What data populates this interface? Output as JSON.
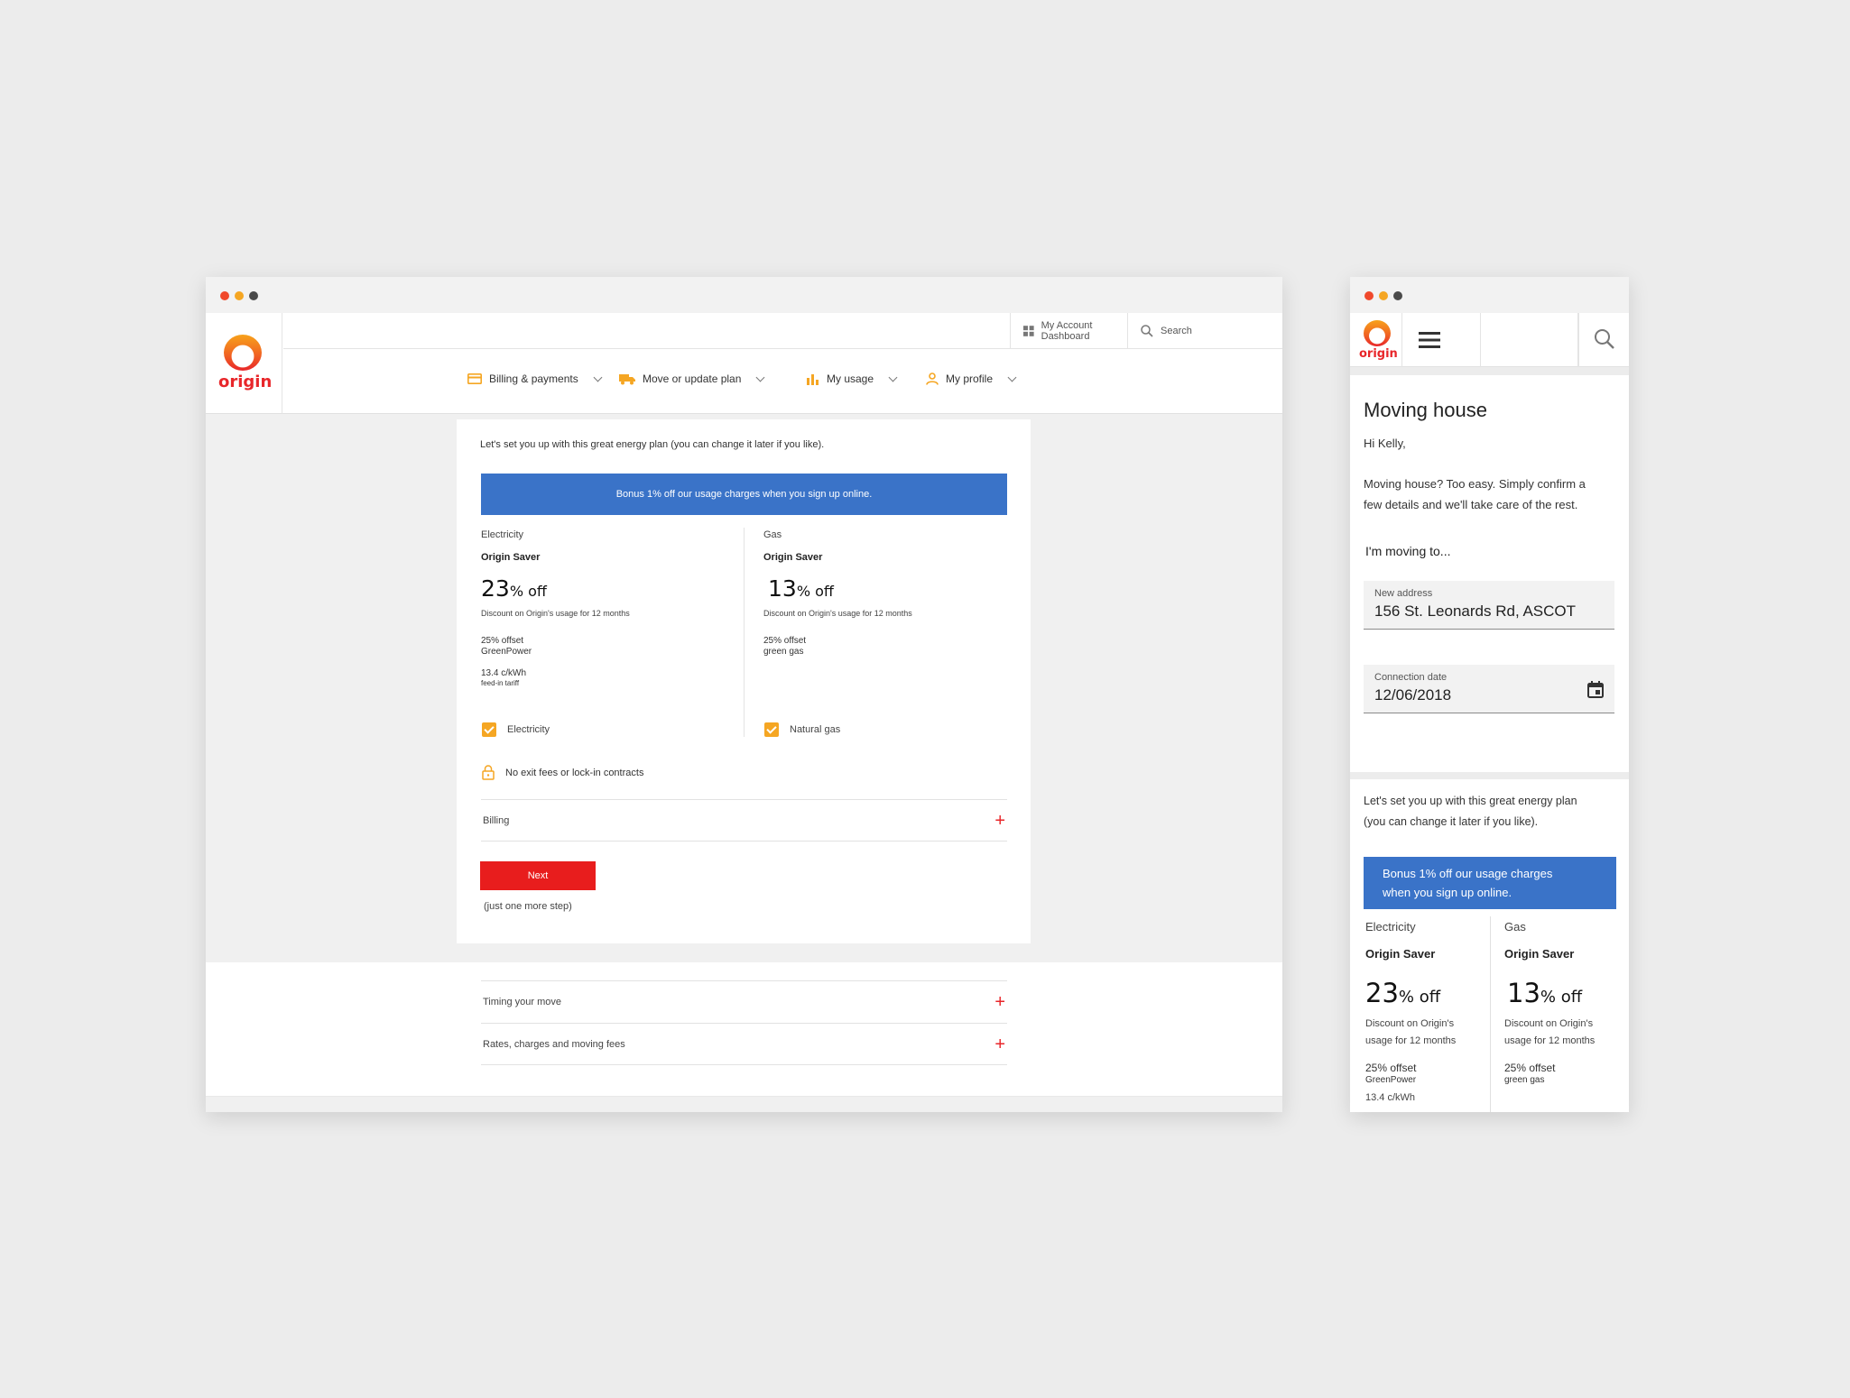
{
  "brand": {
    "name": "origin",
    "primary": "#e8262a",
    "accent": "#f5a623",
    "promo_blue": "#3a73c8"
  },
  "desktop": {
    "topbar": {
      "dashboard_label": "My Account Dashboard",
      "search_label": "Search"
    },
    "nav": [
      {
        "label": "Billing & payments",
        "icon": "credit-card-icon"
      },
      {
        "label": "Move or update plan",
        "icon": "truck-icon"
      },
      {
        "label": "My usage",
        "icon": "bar-chart-icon"
      },
      {
        "label": "My profile",
        "icon": "person-icon"
      }
    ],
    "card": {
      "intro": "Let's set you up with this great energy plan (you can change it later if you like).",
      "promo": "Bonus 1% off our usage charges when you sign up online.",
      "electricity": {
        "type": "Electricity",
        "plan": "Origin Saver",
        "pct": "23",
        "off": "% off",
        "desc": "Discount on Origin's usage for 12 months",
        "offset_line1": "25% offset",
        "offset_line2": "GreenPower",
        "tariff": "13.4 c/kWh",
        "tariff_sub": "feed-in tariff",
        "checkbox_label": "Electricity"
      },
      "gas": {
        "type": "Gas",
        "plan": "Origin Saver",
        "pct": "13",
        "off": "% off",
        "desc": "Discount on Origin's usage for 12 months",
        "offset_line1": "25% offset",
        "offset_line2": "green gas",
        "checkbox_label": "Natural gas"
      },
      "no_exit": "No exit fees or lock-in contracts",
      "billing": "Billing",
      "next": "Next",
      "more_step": "(just one more step)"
    },
    "faq": [
      "Timing your move",
      "Rates, charges and moving fees"
    ]
  },
  "mobile": {
    "title": "Moving house",
    "greeting": "Hi Kelly,",
    "intro_line1": "Moving house? Too easy. Simply confirm a",
    "intro_line2": "few details and we'll take care of the rest.",
    "moving_to": "I'm moving to...",
    "address_label": "New address",
    "address_value": "156 St. Leonards Rd, ASCOT",
    "date_label": "Connection date",
    "date_value": "12/06/2018",
    "plan_line1": "Let's set you up with this great energy plan",
    "plan_line2": "(you can change it later if you like).",
    "promo_line1": "Bonus 1% off our usage charges",
    "promo_line2": "when you sign up online.",
    "electricity": {
      "type": "Electricity",
      "plan": "Origin Saver",
      "pct": "23",
      "off": "% off",
      "desc_line1": "Discount on Origin's",
      "desc_line2": "usage for 12 months",
      "offset_line1": "25% offset",
      "offset_line2": "GreenPower",
      "tariff": "13.4 c/kWh"
    },
    "gas": {
      "type": "Gas",
      "plan": "Origin Saver",
      "pct": "13",
      "off": "% off",
      "desc_line1": "Discount on Origin's",
      "desc_line2": "usage for 12 months",
      "offset_line1": "25% offset",
      "offset_line2": "green gas"
    }
  }
}
